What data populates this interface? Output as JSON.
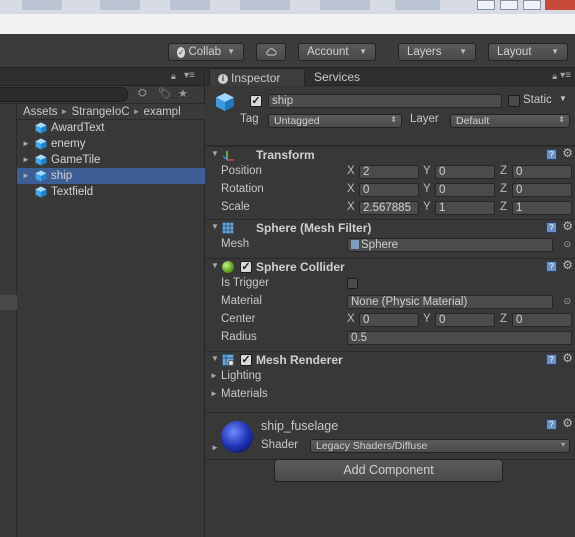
{
  "toolbar": {
    "collab": "Collab",
    "account": "Account",
    "layers": "Layers",
    "layout": "Layout"
  },
  "project": {
    "breadcrumb": [
      "Assets",
      "StrangeIoC",
      "exampl"
    ],
    "assets": [
      {
        "label": "AwardText",
        "expandable": false,
        "selected": false
      },
      {
        "label": "enemy",
        "expandable": true,
        "selected": false
      },
      {
        "label": "GameTile",
        "expandable": true,
        "selected": false
      },
      {
        "label": "ship",
        "expandable": true,
        "selected": true
      },
      {
        "label": "Textfield",
        "expandable": false,
        "selected": false
      }
    ]
  },
  "inspector": {
    "tabs": [
      "Inspector",
      "Services"
    ],
    "object": {
      "name": "ship",
      "static_label": "Static",
      "tag_label": "Tag",
      "tag_value": "Untagged",
      "layer_label": "Layer",
      "layer_value": "Default"
    },
    "transform": {
      "title": "Transform",
      "position": {
        "label": "Position",
        "x": "2",
        "y": "0",
        "z": "0"
      },
      "rotation": {
        "label": "Rotation",
        "x": "0",
        "y": "0",
        "z": "0"
      },
      "scale": {
        "label": "Scale",
        "x": "2.567885",
        "y": "1",
        "z": "1"
      }
    },
    "mesh_filter": {
      "title": "Sphere (Mesh Filter)",
      "mesh_label": "Mesh",
      "mesh_value": "Sphere"
    },
    "sphere_collider": {
      "title": "Sphere Collider",
      "is_trigger_label": "Is Trigger",
      "material_label": "Material",
      "material_value": "None (Physic Material)",
      "center_label": "Center",
      "center_x": "0",
      "center_y": "0",
      "center_z": "0",
      "radius_label": "Radius",
      "radius_value": "0.5"
    },
    "mesh_renderer": {
      "title": "Mesh Renderer",
      "lighting": "Lighting",
      "materials": "Materials"
    },
    "material": {
      "name": "ship_fuselage",
      "shader_label": "Shader",
      "shader_value": "Legacy Shaders/Diffuse"
    },
    "add_component": "Add Component"
  },
  "axes": {
    "x": "X",
    "y": "Y",
    "z": "Z"
  }
}
